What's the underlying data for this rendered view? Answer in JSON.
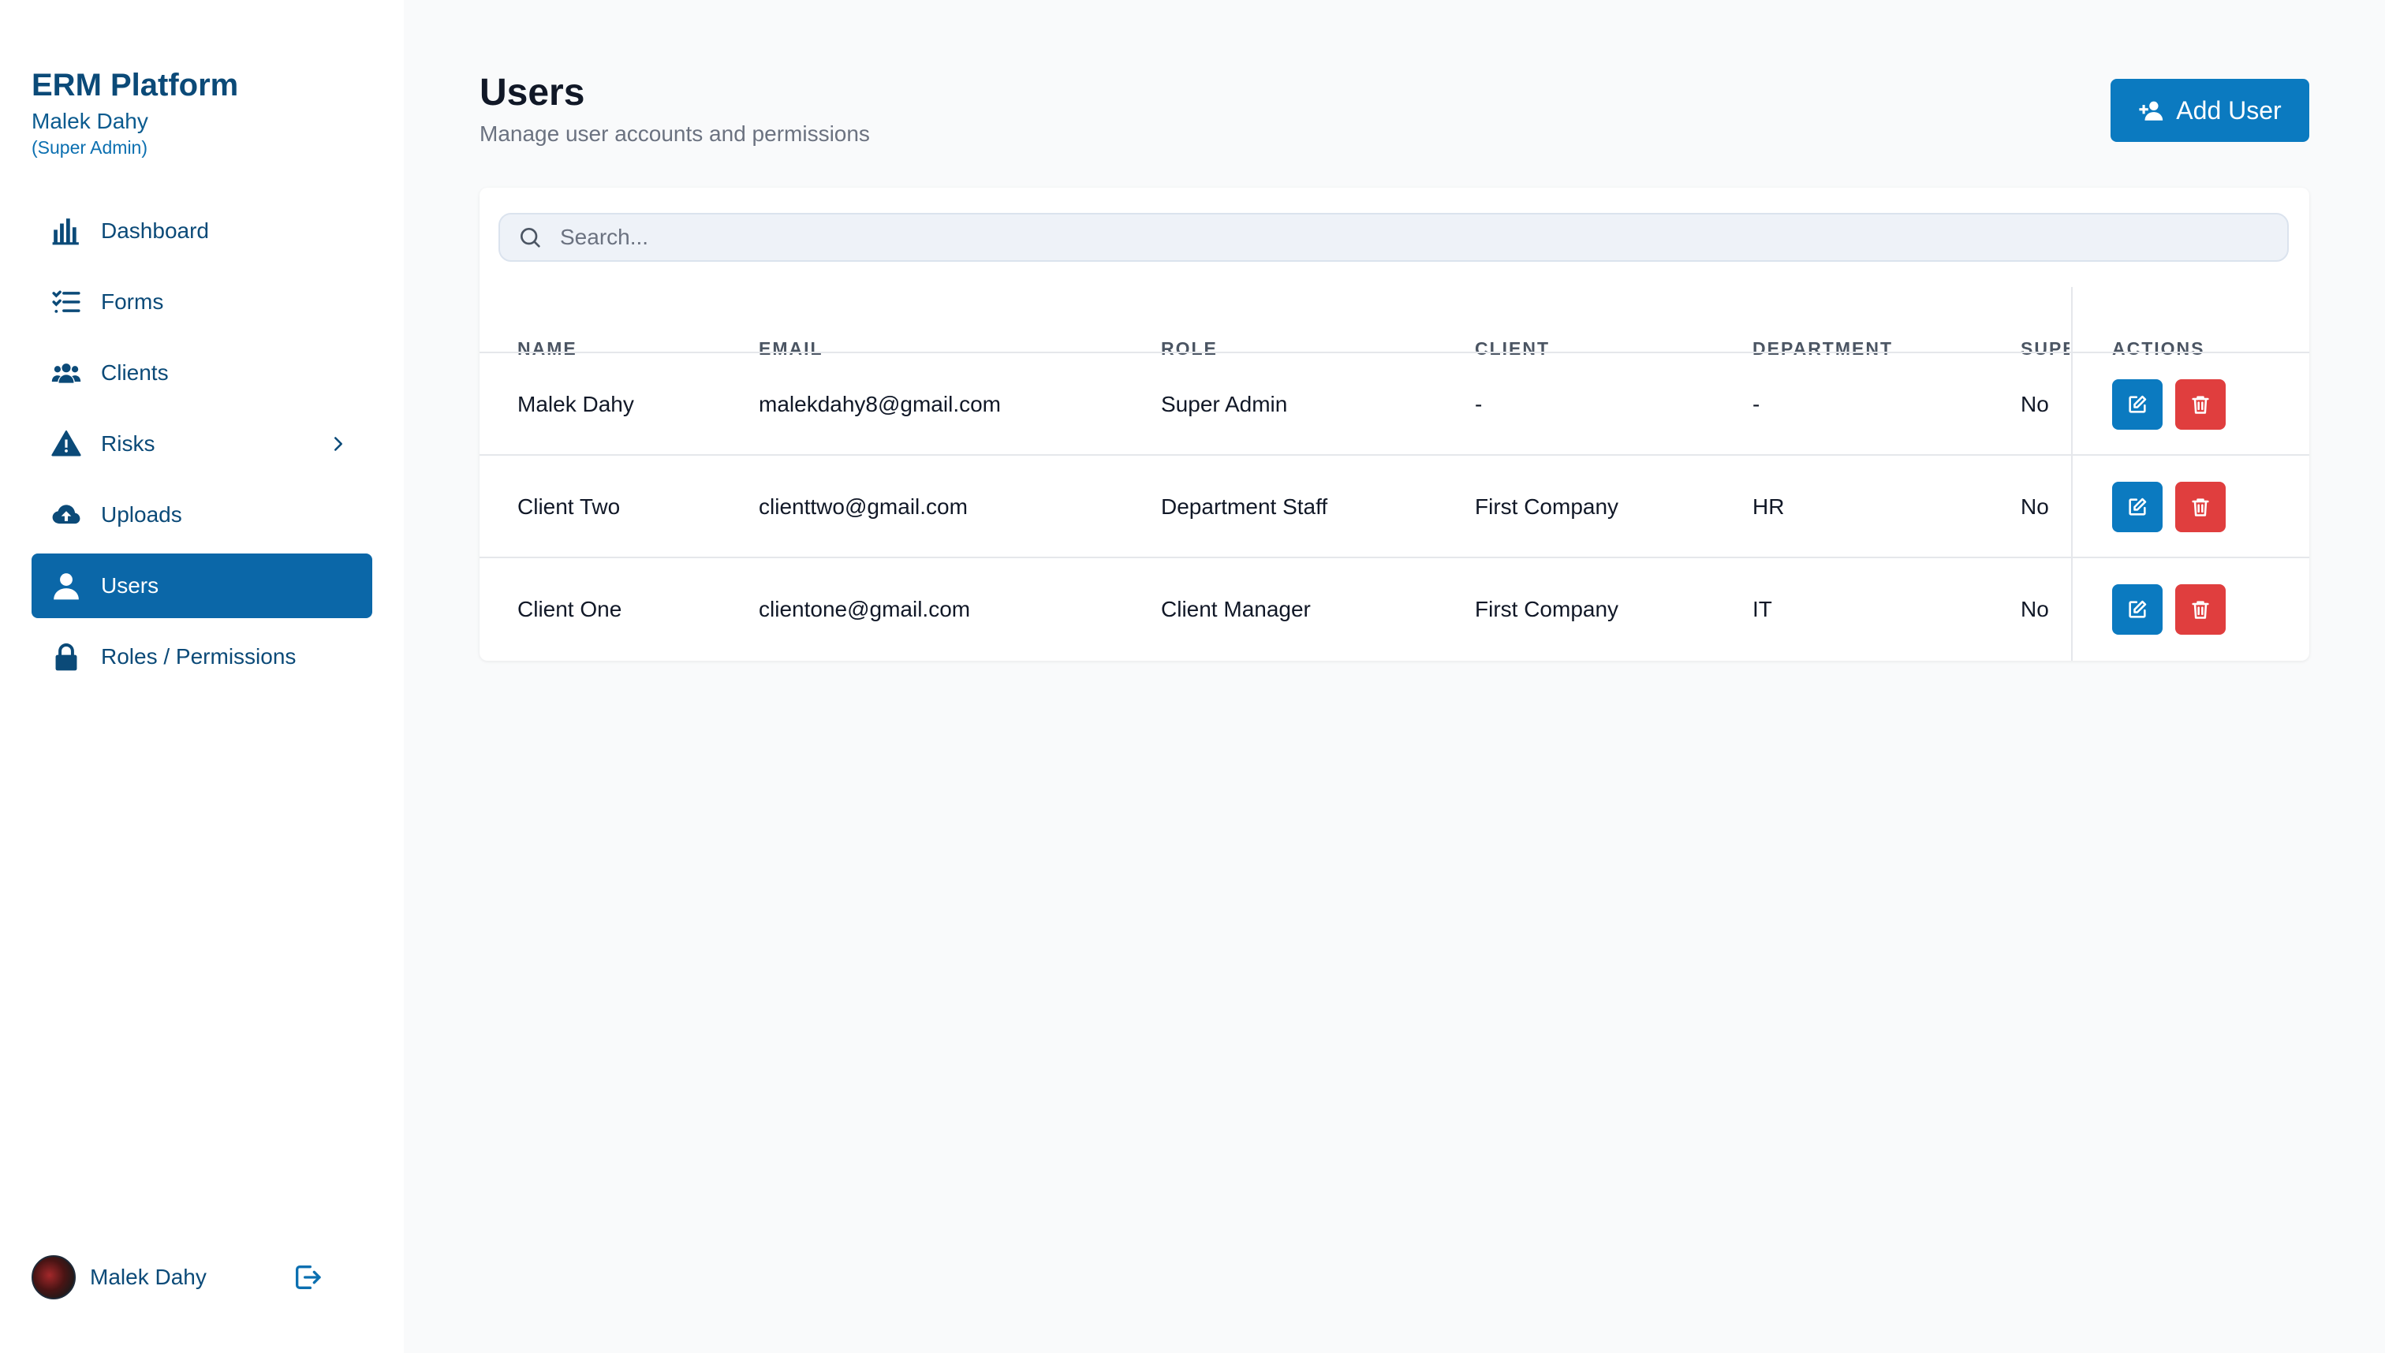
{
  "brand": {
    "title": "ERM Platform",
    "user": "Malek Dahy",
    "role": "(Super Admin)"
  },
  "nav": [
    {
      "label": "Dashboard",
      "icon": "bar-chart-icon"
    },
    {
      "label": "Forms",
      "icon": "checklist-icon"
    },
    {
      "label": "Clients",
      "icon": "users-group-icon"
    },
    {
      "label": "Risks",
      "icon": "warning-icon",
      "has_submenu": true
    },
    {
      "label": "Uploads",
      "icon": "cloud-upload-icon"
    },
    {
      "label": "Users",
      "icon": "user-icon",
      "active": true
    },
    {
      "label": "Roles / Permissions",
      "icon": "lock-icon"
    }
  ],
  "footer": {
    "name": "Malek Dahy"
  },
  "page": {
    "title": "Users",
    "subtitle": "Manage user accounts and permissions",
    "add_button": "Add User"
  },
  "search": {
    "placeholder": "Search...",
    "value": ""
  },
  "table": {
    "columns": [
      "NAME",
      "EMAIL",
      "ROLE",
      "CLIENT",
      "DEPARTMENT",
      "SUPE",
      "ACTIONS"
    ],
    "rows": [
      {
        "name": "Malek Dahy",
        "email": "malekdahy8@gmail.com",
        "role": "Super Admin",
        "client": "-",
        "department": "-",
        "super": "No"
      },
      {
        "name": "Client Two",
        "email": "clienttwo@gmail.com",
        "role": "Department Staff",
        "client": "First Company",
        "department": "HR",
        "super": "No"
      },
      {
        "name": "Client One",
        "email": "clientone@gmail.com",
        "role": "Client Manager",
        "client": "First Company",
        "department": "IT",
        "super": "No"
      }
    ]
  },
  "colors": {
    "brand": "#0b4a78",
    "active_nav": "#0b67a8",
    "primary_button": "#0b7ac0",
    "danger": "#e03e3e"
  }
}
